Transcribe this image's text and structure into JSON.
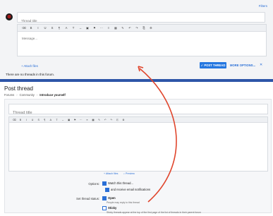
{
  "top": {
    "filters_label": "Filters",
    "title_placeholder": "Thread title",
    "message_placeholder": "Message...",
    "toolbar": [
      "⌫",
      "B",
      "I",
      "U",
      "S",
      "¶",
      "A",
      "T",
      "↔",
      "▣",
      "⚑",
      "⋯",
      "≡",
      "▦",
      "✎",
      "↶",
      "↷",
      "⎘",
      "⚙"
    ],
    "attach_label": "+ Attach files",
    "post_label": "✓ POST THREAD",
    "more_label": "MORE OPTIONS...",
    "close_label": "✕",
    "no_threads": "There are no threads in this forum."
  },
  "bottom": {
    "page_title": "Post thread",
    "breadcrumb": [
      "Forums",
      "Community",
      "Introduce yourself"
    ],
    "title_placeholder": "Thread title",
    "toolbar": [
      "⌫",
      "B",
      "I",
      "U",
      "S",
      "¶",
      "A",
      "T",
      "↔",
      "▣",
      "⚑",
      "⋯",
      "≡",
      "▦",
      "✎",
      "↶",
      "↷",
      "⎘",
      "⚙"
    ],
    "attach_label": "+ Attach files",
    "preview_label": "⌕ Preview",
    "options_label": "Options:",
    "watch_label": "Watch this thread...",
    "email_label": "and receive email notifications",
    "status_label": "Set thread status:",
    "open_label": "Open",
    "open_hint": "People may reply to this thread",
    "sticky_label": "Sticky",
    "sticky_hint": "Sticky threads appear at the top of the first page of the list of threads in their parent forum"
  },
  "colors": {
    "accent": "#2577e0",
    "divider": "#2d55a8",
    "annotation": "#e0452c"
  }
}
